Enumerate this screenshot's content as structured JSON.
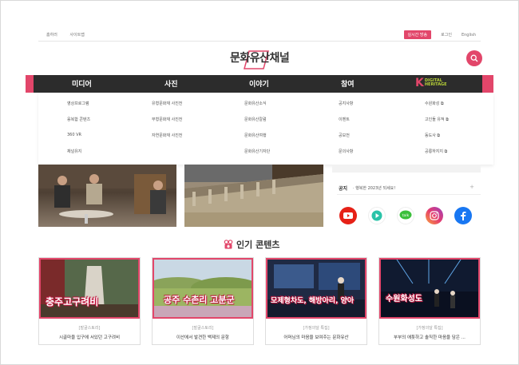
{
  "util": {
    "left": [
      "홈하러",
      "사이트맵"
    ],
    "live_btn": "실시간 방송",
    "login": "로그인",
    "english": "English"
  },
  "logo": {
    "text": "문화유산채널"
  },
  "nav": {
    "items": [
      "미디어",
      "사진",
      "이야기",
      "참여"
    ],
    "heritage_k": "K",
    "heritage_line1": "DIGITAL",
    "heritage_line2": "HERITAGE"
  },
  "dropdown": {
    "col1": [
      "영상프로그램",
      "융복합 콘텐츠",
      "360 VR",
      "채널유지"
    ],
    "col2": [
      "유형문화재 사진전",
      "무형문화재 사진전",
      "자연문화재 사진전"
    ],
    "col3": [
      "문화유산소식",
      "문화유산칼럼",
      "문화유산여행",
      "문화유산기자단"
    ],
    "col4": [
      "공지사항",
      "이벤트",
      "공모전",
      "문의사항"
    ],
    "col5": [
      "수원화성",
      "고인돌 유적",
      "동도사",
      "공릉하지지"
    ]
  },
  "notice": {
    "label": "공지",
    "message": "· 행복한 2023년 되세요!",
    "more": "+"
  },
  "popular": {
    "title": "인기 콘텐츠"
  },
  "cards": [
    {
      "overlay": "충주고구려비",
      "category": "[발굴스토리]",
      "title": "시골마을 입구에 서있던 고구려비"
    },
    {
      "overlay": "공주 수촌리 고분군",
      "category": "[발굴스토리]",
      "title": "이산에서 발견한 백제의 문항"
    },
    {
      "overlay": "모제형차도, 해방아리, 양아",
      "category": "[가정의달 특집]",
      "title": "어머님의 마음을 보여주는 문화유산"
    },
    {
      "overlay": "수원화성도",
      "category": "[가정의달 특집]",
      "title": "부부의 애틋하고 솔직한 마음을 담은 ..."
    }
  ],
  "colors": {
    "accent": "#e2466a",
    "nav_bg": "#2c2c2c",
    "heritage_green": "#b8d238"
  },
  "social": [
    "youtube-icon",
    "play-icon",
    "talk-icon",
    "instagram-icon",
    "facebook-icon"
  ],
  "social_labels": {
    "talk": "talk"
  }
}
